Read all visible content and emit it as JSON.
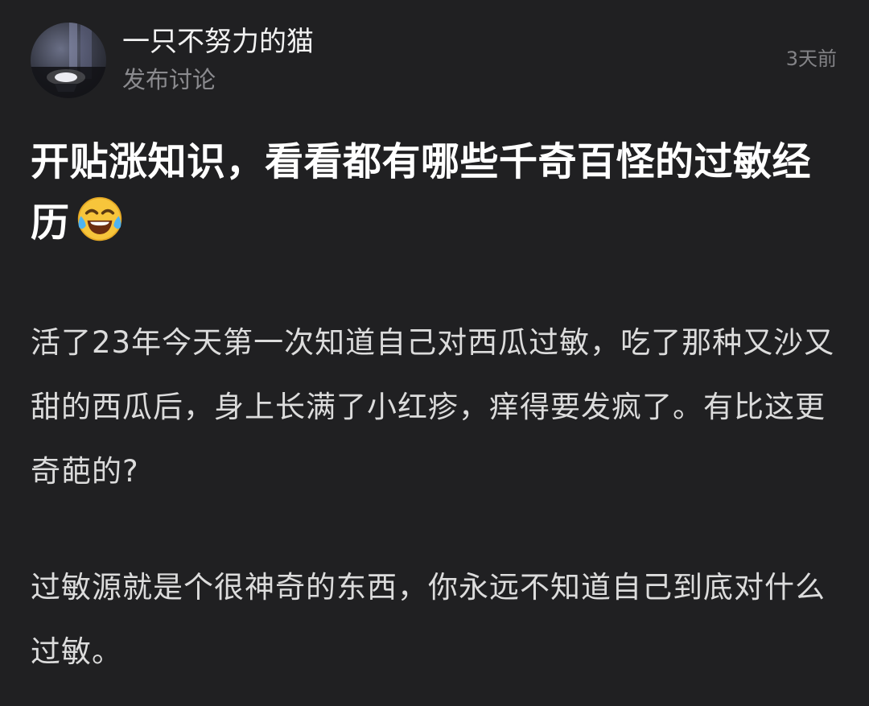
{
  "author": {
    "name": "一只不努力的猫",
    "post_type": "发布讨论",
    "timestamp": "3天前",
    "avatar_icon": "dark-room-lamp-avatar"
  },
  "post": {
    "title": "开贴涨知识，看看都有哪些千奇百怪的过敏经历",
    "title_emoji": "tears-of-joy-emoji",
    "paragraphs": [
      "活了23年今天第一次知道自己对西瓜过敏，吃了那种又沙又甜的西瓜后，身上长满了小红疹，痒得要发疯了。有比这更奇葩的?",
      "过敏源就是个很神奇的东西，你永远不知道自己到底对什么过敏。"
    ]
  },
  "colors": {
    "background": "#202022",
    "title": "#ffffff",
    "body_text": "#dcdcdc",
    "secondary_text": "#8b8b8f"
  }
}
